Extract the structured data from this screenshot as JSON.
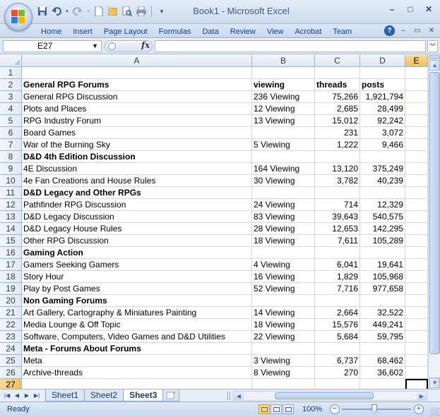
{
  "window": {
    "title": "Book1 - Microsoft Excel"
  },
  "quick_access": [
    "save-icon",
    "undo-icon",
    "redo-icon",
    "new-icon",
    "open-icon",
    "print-preview-icon",
    "print-icon",
    "customize-icon"
  ],
  "ribbon": {
    "tabs": [
      "Home",
      "Insert",
      "Page Layout",
      "Formulas",
      "Data",
      "Review",
      "View",
      "Acrobat",
      "Team"
    ]
  },
  "formula_bar": {
    "name_box": "E27",
    "fx": "fx",
    "formula": ""
  },
  "columns": [
    "A",
    "B",
    "C",
    "D",
    "E"
  ],
  "rows": [
    {
      "n": "1",
      "a": "",
      "b": "",
      "c": "",
      "d": "",
      "bold": false
    },
    {
      "n": "2",
      "a": "General RPG Forums",
      "b": "viewing",
      "c": "threads",
      "d": "posts",
      "bold": true
    },
    {
      "n": "3",
      "a": "General RPG Discussion",
      "b": "236 Viewing",
      "c": "75,266",
      "d": "1,921,794",
      "bold": false
    },
    {
      "n": "4",
      "a": "Plots and Places",
      "b": "12 Viewing",
      "c": "2,685",
      "d": "28,499",
      "bold": false
    },
    {
      "n": "5",
      "a": "RPG Industry Forum",
      "b": "13 Viewing",
      "c": "15,012",
      "d": "92,242",
      "bold": false
    },
    {
      "n": "6",
      "a": "Board Games",
      "b": "",
      "c": "231",
      "d": "3,072",
      "bold": false
    },
    {
      "n": "7",
      "a": "War of the Burning Sky",
      "b": "5 Viewing",
      "c": "1,222",
      "d": "9,466",
      "bold": false
    },
    {
      "n": "8",
      "a": "D&D 4th Edition Discussion",
      "b": "",
      "c": "",
      "d": "",
      "bold": true
    },
    {
      "n": "9",
      "a": "4E Discussion",
      "b": "164 Viewing",
      "c": "13,120",
      "d": "375,249",
      "bold": false
    },
    {
      "n": "10",
      "a": "4e Fan Creations and House Rules",
      "b": "30 Viewing",
      "c": "3,782",
      "d": "40,239",
      "bold": false
    },
    {
      "n": "11",
      "a": "D&D Legacy and Other RPGs",
      "b": "",
      "c": "",
      "d": "",
      "bold": true
    },
    {
      "n": "12",
      "a": "Pathfinder RPG Discussion",
      "b": "24 Viewing",
      "c": "714",
      "d": "12,329",
      "bold": false
    },
    {
      "n": "13",
      "a": "D&D Legacy Discussion",
      "b": "83 Viewing",
      "c": "39,643",
      "d": "540,575",
      "bold": false
    },
    {
      "n": "14",
      "a": "D&D Legacy House Rules",
      "b": "28 Viewing",
      "c": "12,653",
      "d": "142,295",
      "bold": false
    },
    {
      "n": "15",
      "a": "Other RPG Discussion",
      "b": "18 Viewing",
      "c": "7,611",
      "d": "105,289",
      "bold": false
    },
    {
      "n": "16",
      "a": "Gaming Action",
      "b": "",
      "c": "",
      "d": "",
      "bold": true
    },
    {
      "n": "17",
      "a": "Gamers Seeking Gamers",
      "b": "4 Viewing",
      "c": "6,041",
      "d": "19,641",
      "bold": false
    },
    {
      "n": "18",
      "a": "Story Hour",
      "b": "16 Viewing",
      "c": "1,829",
      "d": "105,968",
      "bold": false
    },
    {
      "n": "19",
      "a": "Play by Post Games",
      "b": "52 Viewing",
      "c": "7,716",
      "d": "977,658",
      "bold": false
    },
    {
      "n": "20",
      "a": "Non Gaming Forums",
      "b": "",
      "c": "",
      "d": "",
      "bold": true
    },
    {
      "n": "21",
      "a": "Art Gallery, Cartography & Miniatures Painting",
      "b": "14 Viewing",
      "c": "2,664",
      "d": "32,522",
      "bold": false
    },
    {
      "n": "22",
      "a": "Media Lounge & Off Topic",
      "b": "18 Viewing",
      "c": "15,576",
      "d": "449,241",
      "bold": false
    },
    {
      "n": "23",
      "a": "Software, Computers, Video Games and D&D Utilities",
      "b": "22 Viewing",
      "c": "5,684",
      "d": "59,795",
      "bold": false
    },
    {
      "n": "24",
      "a": "Meta - Forums About Forums",
      "b": "",
      "c": "",
      "d": "",
      "bold": true
    },
    {
      "n": "25",
      "a": "Meta",
      "b": "3 Viewing",
      "c": "6,737",
      "d": "68,462",
      "bold": false
    },
    {
      "n": "26",
      "a": "Archive-threads",
      "b": "8 Viewing",
      "c": "270",
      "d": "36,602",
      "bold": false
    },
    {
      "n": "27",
      "a": "",
      "b": "",
      "c": "",
      "d": "",
      "bold": false
    }
  ],
  "sheets": [
    {
      "name": "Sheet1",
      "active": false
    },
    {
      "name": "Sheet2",
      "active": false
    },
    {
      "name": "Sheet3",
      "active": true
    }
  ],
  "status": {
    "text": "Ready",
    "zoom": "100%",
    "zoom_percent": 100
  },
  "colors": {
    "accent": "#15428b",
    "selected_header": "#f1c15f"
  }
}
